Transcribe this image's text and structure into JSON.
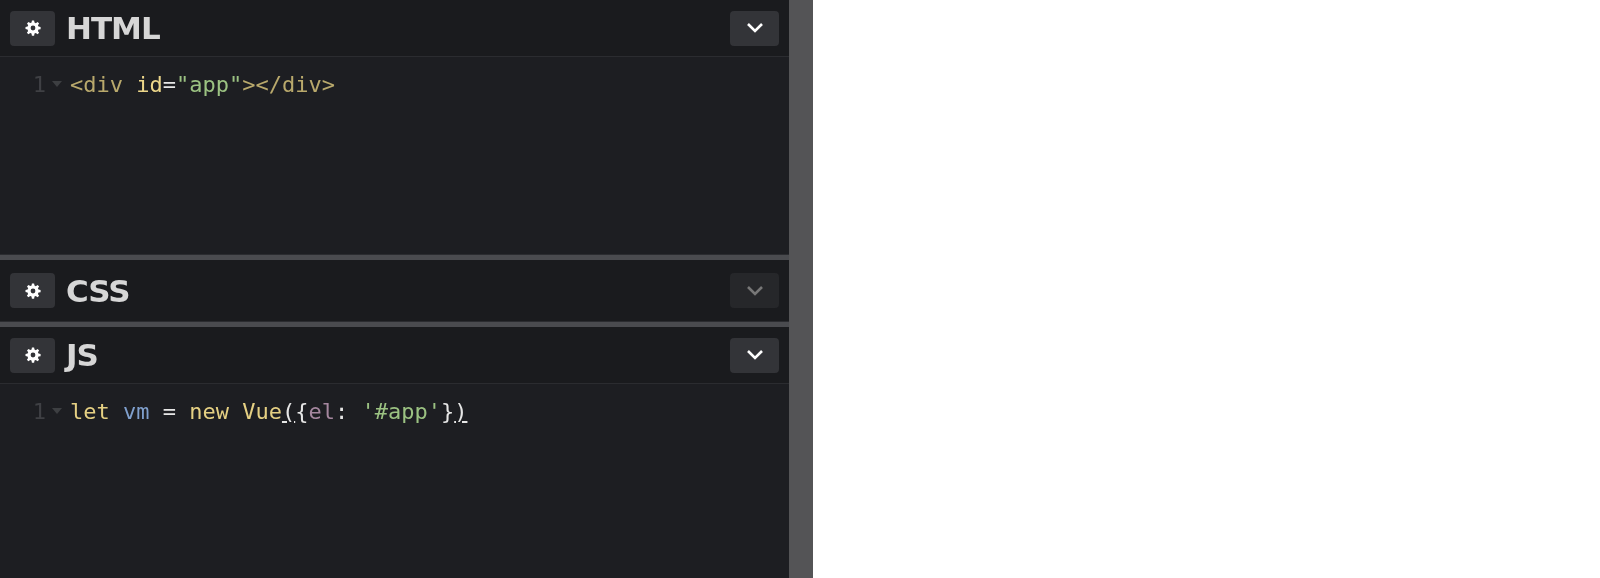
{
  "panels": [
    {
      "title": "HTML",
      "expanded": true,
      "lines": [
        {
          "number": "1",
          "tokens": [
            {
              "text": "<div ",
              "kind": "tag"
            },
            {
              "text": "id",
              "kind": "attr"
            },
            {
              "text": "=",
              "kind": "punct"
            },
            {
              "text": "\"app\"",
              "kind": "string"
            },
            {
              "text": "></div>",
              "kind": "tag"
            }
          ]
        }
      ]
    },
    {
      "title": "CSS",
      "expanded": false
    },
    {
      "title": "JS",
      "expanded": true,
      "lines": [
        {
          "number": "1",
          "tokens": [
            {
              "text": "let ",
              "kind": "keyword"
            },
            {
              "text": "vm",
              "kind": "variable"
            },
            {
              "text": " = ",
              "kind": "punct"
            },
            {
              "text": "new Vue",
              "kind": "keyword"
            },
            {
              "text": "(",
              "kind": "bracket-match"
            },
            {
              "text": "{",
              "kind": "punct"
            },
            {
              "text": "el",
              "kind": "property"
            },
            {
              "text": ": ",
              "kind": "punct"
            },
            {
              "text": "'#app'",
              "kind": "string"
            },
            {
              "text": "}",
              "kind": "punct"
            },
            {
              "text": ")",
              "kind": "bracket-match"
            }
          ]
        }
      ]
    }
  ]
}
